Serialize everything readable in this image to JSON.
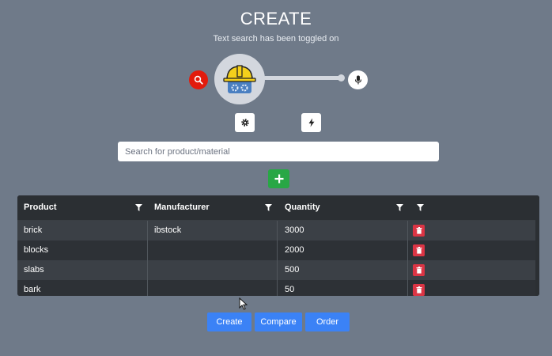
{
  "header": {
    "title": "CREATE",
    "subtitle": "Text search has been toggled on"
  },
  "search": {
    "placeholder": "Search for product/material"
  },
  "colors": {
    "background": "#6f7a89",
    "search_toggle": "#e21b0c",
    "add_button": "#28a745",
    "delete_button": "#dc3545",
    "primary_button": "#3b82f6",
    "grid_header": "#2b2f33"
  },
  "icons": {
    "search_toggle": "search-icon",
    "logo": "hard-hat-gears-logo",
    "mic": "microphone-icon",
    "settings": "gear-icon",
    "bolt": "lightning-bolt-icon",
    "add": "plus-icon",
    "filter": "filter-icon",
    "delete": "trash-icon"
  },
  "table": {
    "columns": [
      {
        "label": "Product"
      },
      {
        "label": "Manufacturer"
      },
      {
        "label": "Quantity"
      }
    ],
    "rows": [
      {
        "product": "brick",
        "manufacturer": "ibstock",
        "quantity": "3000"
      },
      {
        "product": "blocks",
        "manufacturer": "",
        "quantity": "2000"
      },
      {
        "product": "slabs",
        "manufacturer": "",
        "quantity": "500"
      },
      {
        "product": "bark",
        "manufacturer": "",
        "quantity": "50"
      }
    ]
  },
  "actions": {
    "create": "Create",
    "compare": "Compare",
    "order": "Order"
  }
}
